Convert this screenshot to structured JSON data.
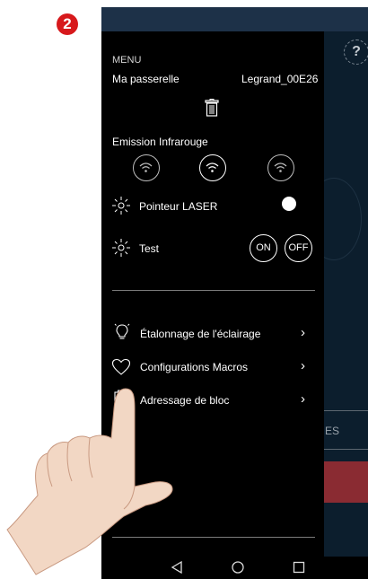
{
  "step_number": "2",
  "menu": {
    "title": "MENU",
    "gateway_label": "Ma passerelle",
    "gateway_value": "Legrand_00E26",
    "ir_label": "Emission Infrarouge",
    "laser_label": "Pointeur LASER",
    "test_label": "Test",
    "on_label": "ON",
    "off_label": "OFF",
    "items": [
      {
        "label": "Étalonnage de l'éclairage",
        "icon": "bulb-icon"
      },
      {
        "label": "Configurations Macros",
        "icon": "heart-icon"
      },
      {
        "label": "Adressage de bloc",
        "icon": "battery-icon"
      }
    ]
  },
  "background": {
    "help_label": "?",
    "button_partial": "ES"
  },
  "colors": {
    "status_bar": "#1d3148",
    "badge": "#d7191c",
    "drawer_bg": "#000000",
    "underlay": "#0c1e2d",
    "red_button": "#8a2b32"
  }
}
